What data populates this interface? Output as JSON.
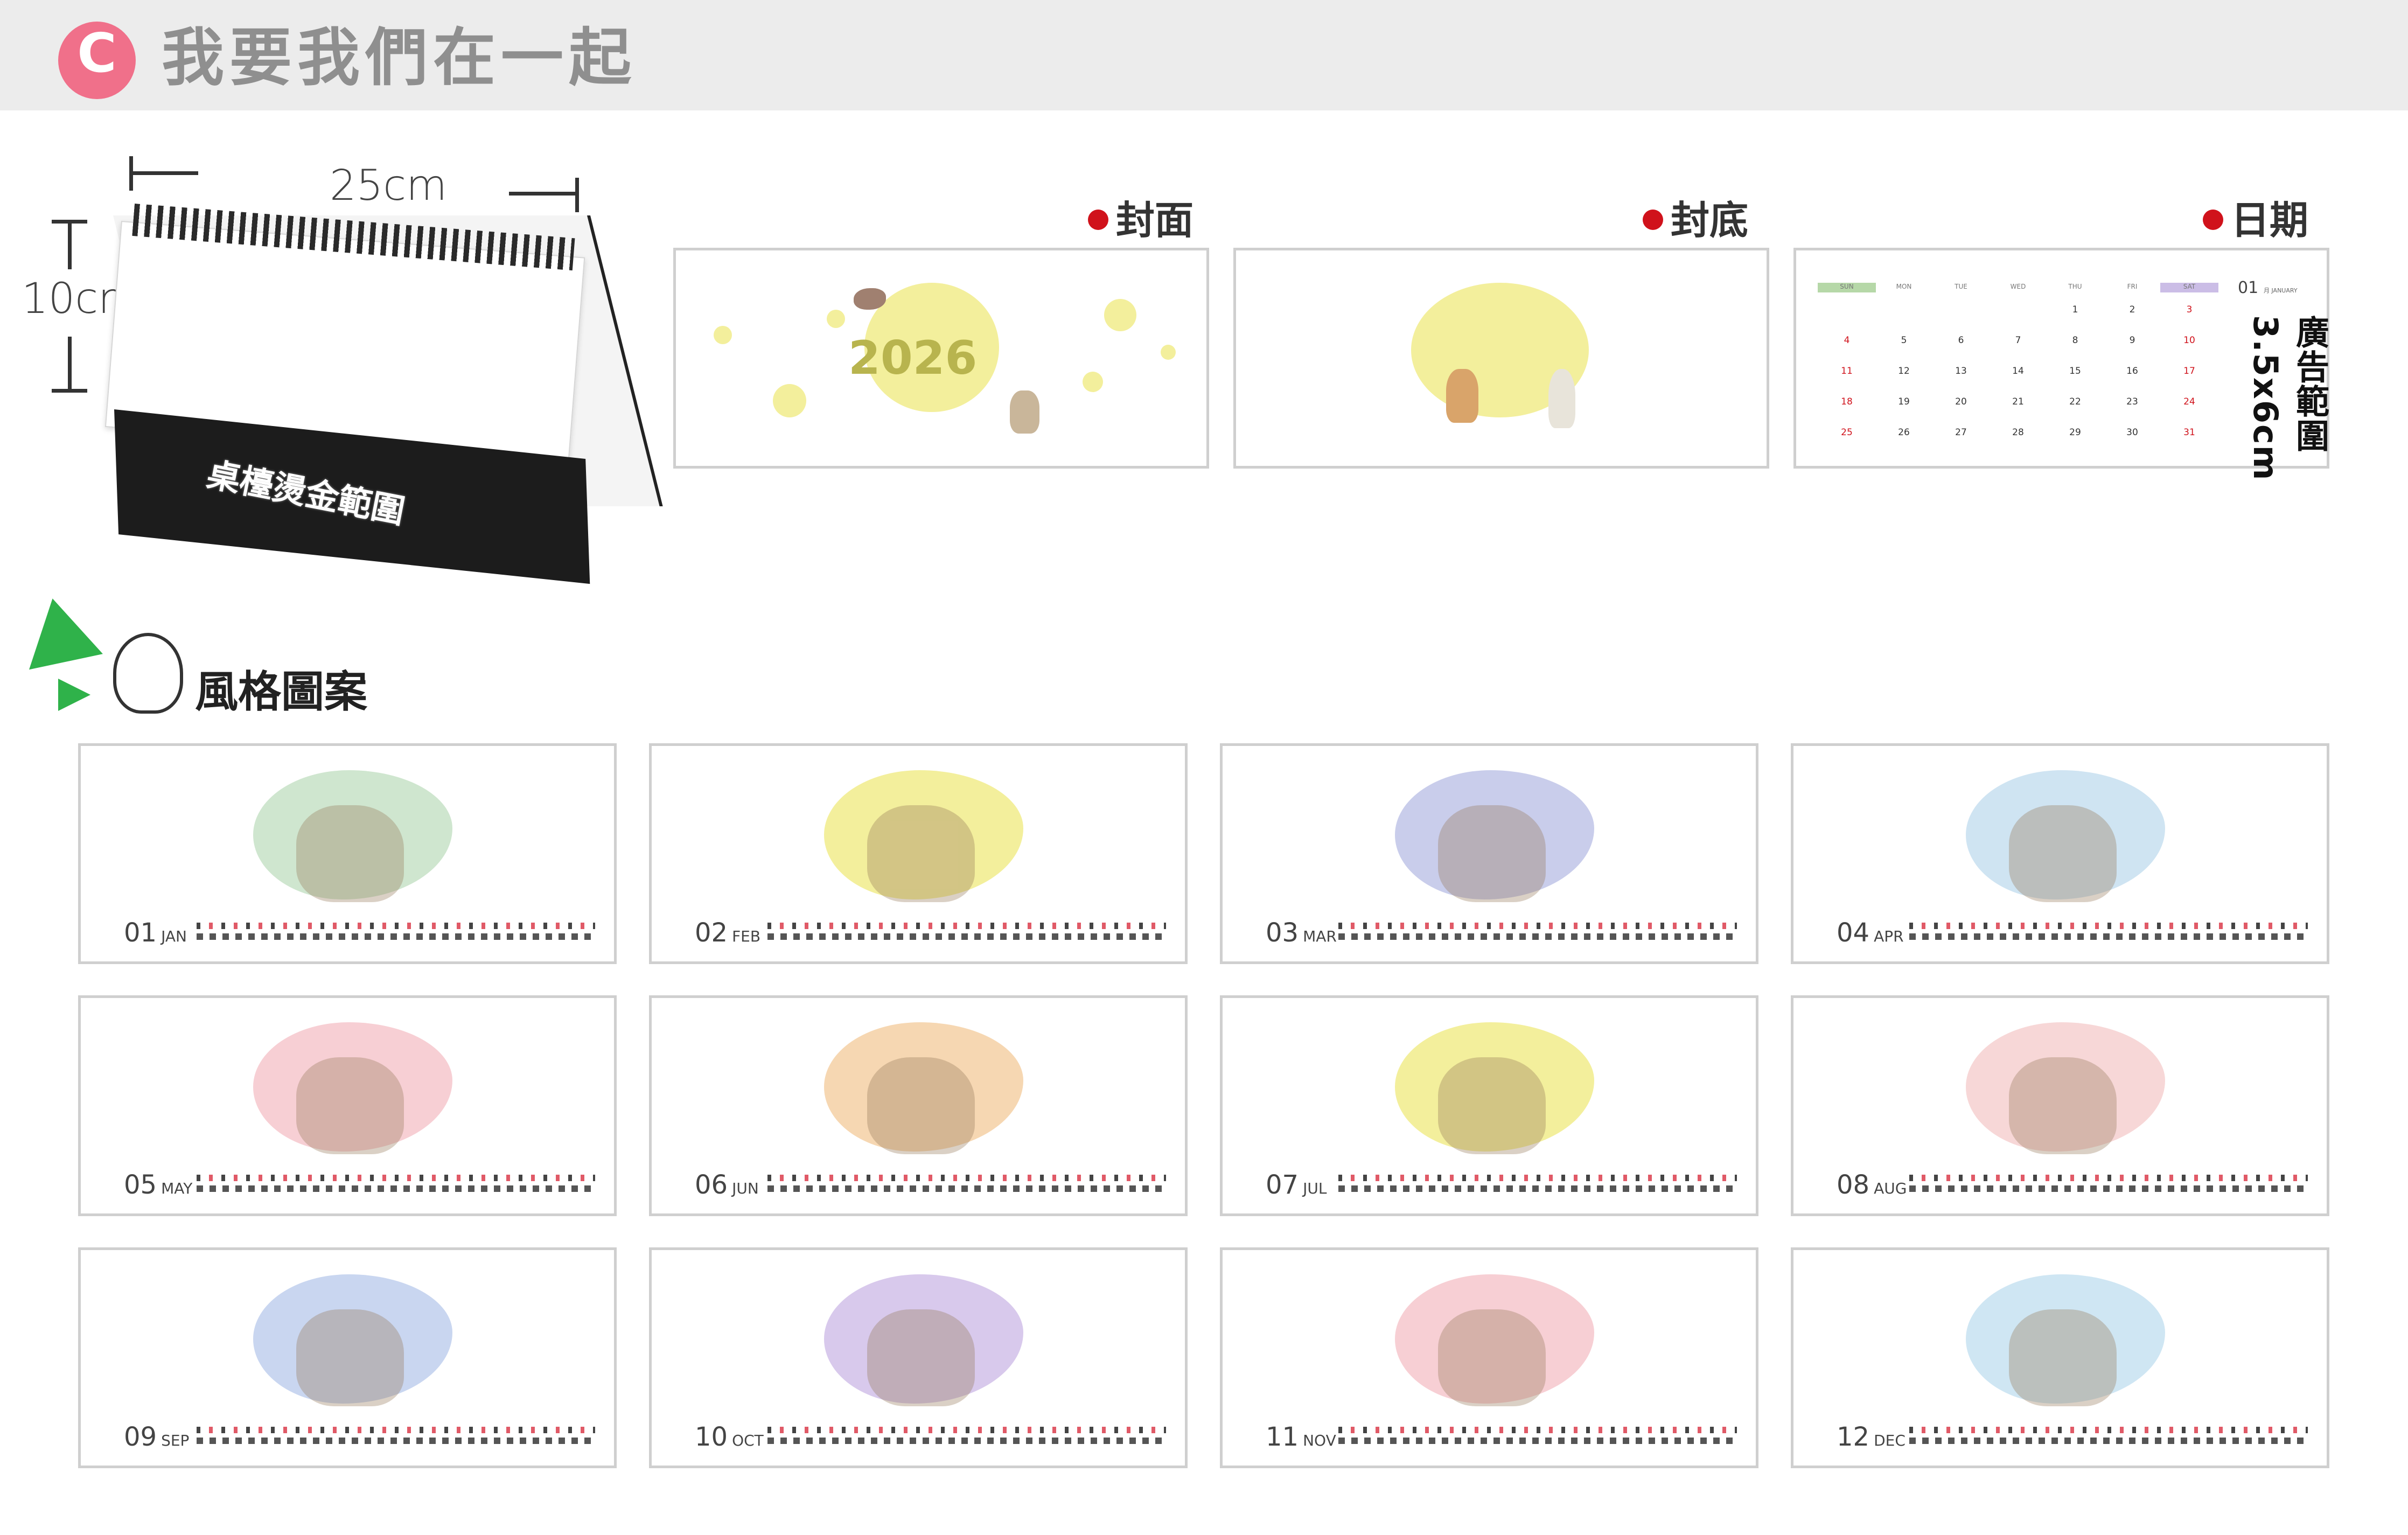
{
  "header": {
    "badge": "C",
    "title": "我要我們在一起"
  },
  "product": {
    "width_label": "25cm",
    "height_label": "10cm",
    "foil_label": "桌檯燙金範圍"
  },
  "previews": {
    "cover": {
      "label": "封面",
      "year": "2026"
    },
    "back": {
      "label": "封底"
    },
    "dates": {
      "label": "日期",
      "month_num": "01",
      "month_name": "月 JANUARY",
      "ad_label": "廣告範圍 3.5x6cm",
      "weekday_headers": [
        "SUN",
        "MON",
        "TUE",
        "WED",
        "THU",
        "FRI",
        "SAT"
      ],
      "weeks": [
        [
          "",
          "",
          "",
          "",
          "1",
          "2",
          "3"
        ],
        [
          "4",
          "5",
          "6",
          "7",
          "8",
          "9",
          "10"
        ],
        [
          "11",
          "12",
          "13",
          "14",
          "15",
          "16",
          "17"
        ],
        [
          "18",
          "19",
          "20",
          "21",
          "22",
          "23",
          "24"
        ],
        [
          "25",
          "26",
          "27",
          "28",
          "29",
          "30",
          "31"
        ]
      ]
    }
  },
  "style_section": {
    "title": "風格圖案"
  },
  "months": [
    {
      "num": "01",
      "abbr": "JAN",
      "blob": "#cfe6cf"
    },
    {
      "num": "02",
      "abbr": "FEB",
      "blob": "#f3ef9c"
    },
    {
      "num": "03",
      "abbr": "MAR",
      "blob": "#c9cdeb"
    },
    {
      "num": "04",
      "abbr": "APR",
      "blob": "#cfe4f2"
    },
    {
      "num": "05",
      "abbr": "MAY",
      "blob": "#f7cfd4"
    },
    {
      "num": "06",
      "abbr": "JUN",
      "blob": "#f6d7b2"
    },
    {
      "num": "07",
      "abbr": "JUL",
      "blob": "#f3ef9c"
    },
    {
      "num": "08",
      "abbr": "AUG",
      "blob": "#f7d7d7"
    },
    {
      "num": "09",
      "abbr": "SEP",
      "blob": "#c9d6f0"
    },
    {
      "num": "10",
      "abbr": "OCT",
      "blob": "#d8c9ec"
    },
    {
      "num": "11",
      "abbr": "NOV",
      "blob": "#f7cfd4"
    },
    {
      "num": "12",
      "abbr": "DEC",
      "blob": "#cfe6f3"
    }
  ],
  "colors": {
    "header_bg": "#ececec",
    "badge": "#f0708a",
    "dot": "#d0121b",
    "frame": "#cfcfcf"
  }
}
